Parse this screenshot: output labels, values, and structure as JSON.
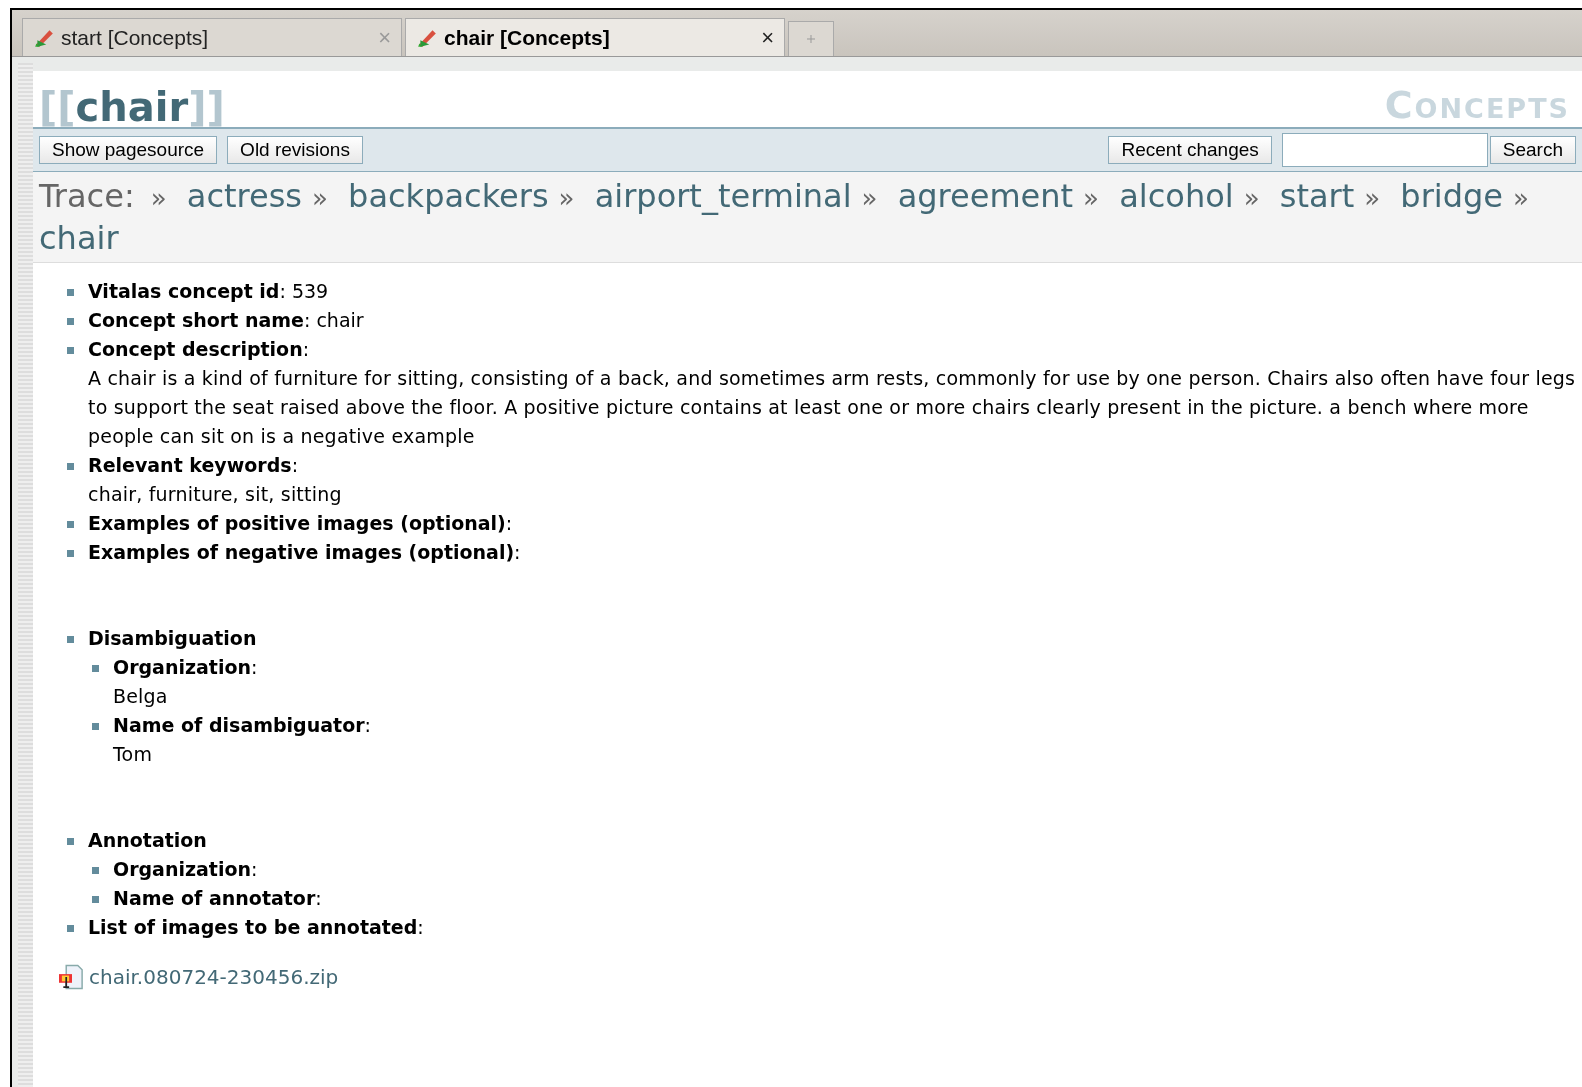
{
  "tabs": [
    {
      "label": "start [Concepts]",
      "selected": false,
      "close": "×"
    },
    {
      "label": "chair [Concepts]",
      "selected": true,
      "close": "×"
    }
  ],
  "page": {
    "title": "chair",
    "bracket_open": "[[",
    "bracket_close": "]]",
    "wiki_name": "Concepts"
  },
  "toolbar": {
    "left_buttons": [
      "Show pagesource",
      "Old revisions"
    ],
    "recent_button": "Recent changes",
    "search_button": "Search"
  },
  "trace": {
    "label": "Trace:",
    "crumbs": [
      {
        "sep": "»",
        "name": "actress"
      },
      {
        "sep": "»",
        "name": "backpackers"
      },
      {
        "sep": "»",
        "name": "airport_terminal"
      },
      {
        "sep": "»",
        "name": "agreement"
      },
      {
        "sep": "»",
        "name": "alcohol"
      },
      {
        "sep": "»",
        "name": "start"
      },
      {
        "sep": "»",
        "name": "bridge"
      },
      {
        "sep": "»",
        "name": "chair"
      }
    ]
  },
  "fields": [
    {
      "kind": "field",
      "text": "**Vitalas concept id**: 539"
    },
    {
      "kind": "field",
      "text": "**Concept short name**: chair"
    },
    {
      "kind": "field",
      "text": "**Concept description**:",
      "value": "A chair is a kind of furniture for sitting, consisting of a back, and sometimes arm rests, commonly for use by one person. Chairs also often have four legs to support the seat raised above the floor. A positive picture contains at least one or more chairs clearly present in the picture. a bench where more people can sit on is a negative example"
    },
    {
      "kind": "field",
      "text": "**Relevant keywords**:",
      "value": "chair, furniture, sit, sitting"
    },
    {
      "kind": "field",
      "text": "**Examples of positive images (optional)**:"
    },
    {
      "kind": "field",
      "text": "**Examples of negative images (optional)**:"
    },
    {
      "kind": "section",
      "text": "**Disambiguation**",
      "children": [
        {
          "text": "**Organization**:",
          "value": "Belga"
        },
        {
          "text": "**Name of disambiguator**:",
          "value": "Tom"
        }
      ]
    },
    {
      "kind": "section",
      "text": "**Annotation**",
      "children": [
        {
          "text": "**Organization**:"
        },
        {
          "text": "**Name of annotator**:"
        }
      ]
    },
    {
      "kind": "field",
      "text": "**List of images to be annotated**:"
    }
  ],
  "attachment": "chair.080724-230456.zip"
}
